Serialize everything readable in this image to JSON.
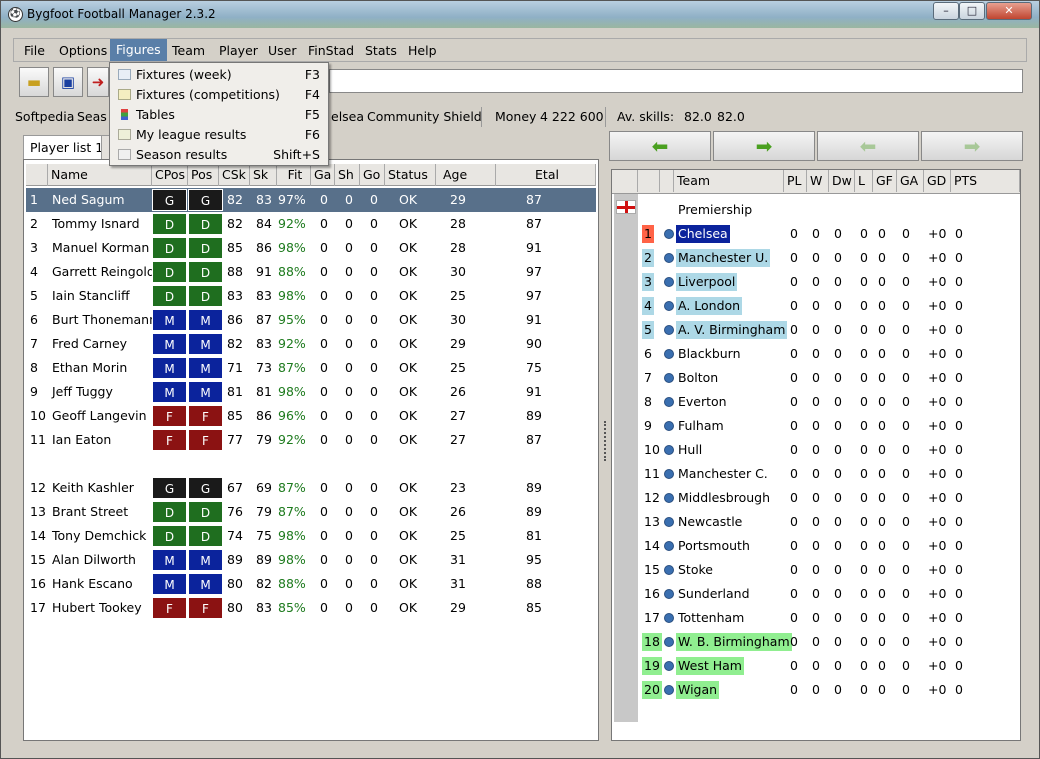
{
  "window": {
    "title": "Bygfoot Football Manager 2.3.2",
    "minimize": "–",
    "maximize": "□",
    "close": "✕"
  },
  "menu": [
    "File",
    "Options",
    "Figures",
    "Team",
    "Player",
    "User",
    "FinStad",
    "Stats",
    "Help"
  ],
  "figures_menu": [
    {
      "label": "Fixtures (week)",
      "shortcut": "F3",
      "icon": "calendar-icon"
    },
    {
      "label": "Fixtures (competitions)",
      "shortcut": "F4",
      "icon": "calendar-icon"
    },
    {
      "label": "Tables",
      "shortcut": "F5",
      "icon": "table-icon"
    },
    {
      "label": "My league results",
      "shortcut": "F6",
      "icon": "results-icon"
    },
    {
      "label": "Season results",
      "shortcut": "Shift+S",
      "icon": "season-icon"
    }
  ],
  "infobar": {
    "softpedia": "Softpedia",
    "season_prefix": "Seas",
    "comp_partial": "elsea",
    "competition": "Community Shield",
    "money_label": "Money",
    "money_value": "4 222 600",
    "skills_label": "Av. skills:",
    "skills_a": "82.0",
    "skills_b": "82.0"
  },
  "tabs": {
    "player_list": "Player list 1",
    "other": "P"
  },
  "player_columns": [
    "Name",
    "CPos",
    "Pos",
    "CSk",
    "Sk",
    "Fit",
    "Ga",
    "Sh",
    "Go",
    "Status",
    "Age",
    "Etal"
  ],
  "players": [
    {
      "n": "1",
      "name": "Ned Sagum",
      "cpos": "G",
      "pos": "G",
      "csk": "82",
      "sk": "83",
      "fit": "97%",
      "ga": "0",
      "sh": "0",
      "go": "0",
      "status": "OK",
      "age": "29",
      "etal": "87"
    },
    {
      "n": "2",
      "name": "Tommy Isnard",
      "cpos": "D",
      "pos": "D",
      "csk": "82",
      "sk": "84",
      "fit": "92%",
      "ga": "0",
      "sh": "0",
      "go": "0",
      "status": "OK",
      "age": "28",
      "etal": "87"
    },
    {
      "n": "3",
      "name": "Manuel Korman",
      "cpos": "D",
      "pos": "D",
      "csk": "85",
      "sk": "86",
      "fit": "98%",
      "ga": "0",
      "sh": "0",
      "go": "0",
      "status": "OK",
      "age": "28",
      "etal": "91"
    },
    {
      "n": "4",
      "name": "Garrett Reingold",
      "cpos": "D",
      "pos": "D",
      "csk": "88",
      "sk": "91",
      "fit": "88%",
      "ga": "0",
      "sh": "0",
      "go": "0",
      "status": "OK",
      "age": "30",
      "etal": "97"
    },
    {
      "n": "5",
      "name": "Iain Stancliff",
      "cpos": "D",
      "pos": "D",
      "csk": "83",
      "sk": "83",
      "fit": "98%",
      "ga": "0",
      "sh": "0",
      "go": "0",
      "status": "OK",
      "age": "25",
      "etal": "97"
    },
    {
      "n": "6",
      "name": "Burt Thonemann",
      "cpos": "M",
      "pos": "M",
      "csk": "86",
      "sk": "87",
      "fit": "95%",
      "ga": "0",
      "sh": "0",
      "go": "0",
      "status": "OK",
      "age": "30",
      "etal": "91"
    },
    {
      "n": "7",
      "name": "Fred Carney",
      "cpos": "M",
      "pos": "M",
      "csk": "82",
      "sk": "83",
      "fit": "92%",
      "ga": "0",
      "sh": "0",
      "go": "0",
      "status": "OK",
      "age": "29",
      "etal": "90"
    },
    {
      "n": "8",
      "name": "Ethan Morin",
      "cpos": "M",
      "pos": "M",
      "csk": "71",
      "sk": "73",
      "fit": "87%",
      "ga": "0",
      "sh": "0",
      "go": "0",
      "status": "OK",
      "age": "25",
      "etal": "75"
    },
    {
      "n": "9",
      "name": "Jeff Tuggy",
      "cpos": "M",
      "pos": "M",
      "csk": "81",
      "sk": "81",
      "fit": "98%",
      "ga": "0",
      "sh": "0",
      "go": "0",
      "status": "OK",
      "age": "26",
      "etal": "91"
    },
    {
      "n": "10",
      "name": "Geoff Langevin",
      "cpos": "F",
      "pos": "F",
      "csk": "85",
      "sk": "86",
      "fit": "96%",
      "ga": "0",
      "sh": "0",
      "go": "0",
      "status": "OK",
      "age": "27",
      "etal": "89"
    },
    {
      "n": "11",
      "name": "Ian Eaton",
      "cpos": "F",
      "pos": "F",
      "csk": "77",
      "sk": "79",
      "fit": "92%",
      "ga": "0",
      "sh": "0",
      "go": "0",
      "status": "OK",
      "age": "27",
      "etal": "87"
    },
    {
      "n": "12",
      "name": "Keith Kashler",
      "cpos": "G",
      "pos": "G",
      "csk": "67",
      "sk": "69",
      "fit": "87%",
      "ga": "0",
      "sh": "0",
      "go": "0",
      "status": "OK",
      "age": "23",
      "etal": "89"
    },
    {
      "n": "13",
      "name": "Brant Street",
      "cpos": "D",
      "pos": "D",
      "csk": "76",
      "sk": "79",
      "fit": "87%",
      "ga": "0",
      "sh": "0",
      "go": "0",
      "status": "OK",
      "age": "26",
      "etal": "89"
    },
    {
      "n": "14",
      "name": "Tony Demchick",
      "cpos": "D",
      "pos": "D",
      "csk": "74",
      "sk": "75",
      "fit": "98%",
      "ga": "0",
      "sh": "0",
      "go": "0",
      "status": "OK",
      "age": "25",
      "etal": "81"
    },
    {
      "n": "15",
      "name": "Alan Dilworth",
      "cpos": "M",
      "pos": "M",
      "csk": "89",
      "sk": "89",
      "fit": "98%",
      "ga": "0",
      "sh": "0",
      "go": "0",
      "status": "OK",
      "age": "31",
      "etal": "95"
    },
    {
      "n": "16",
      "name": "Hank Escano",
      "cpos": "M",
      "pos": "M",
      "csk": "80",
      "sk": "82",
      "fit": "88%",
      "ga": "0",
      "sh": "0",
      "go": "0",
      "status": "OK",
      "age": "31",
      "etal": "88"
    },
    {
      "n": "17",
      "name": "Hubert Tookey",
      "cpos": "F",
      "pos": "F",
      "csk": "80",
      "sk": "83",
      "fit": "85%",
      "ga": "0",
      "sh": "0",
      "go": "0",
      "status": "OK",
      "age": "29",
      "etal": "85"
    }
  ],
  "position_colors": {
    "G": "#1a1a1a",
    "D": "#1f6e1f",
    "M": "#0b239c",
    "F": "#8b1212"
  },
  "table_columns": [
    "Team",
    "PL",
    "W",
    "Dw",
    "L",
    "GF",
    "GA",
    "GD",
    "PTS"
  ],
  "league_name": "Premiership",
  "teams": [
    {
      "r": "1",
      "name": "Chelsea",
      "pl": "0",
      "w": "0",
      "dw": "0",
      "l": "0",
      "gf": "0",
      "ga": "0",
      "gd": "+0",
      "pts": "0",
      "zone": "champ"
    },
    {
      "r": "2",
      "name": "Manchester U.",
      "pl": "0",
      "w": "0",
      "dw": "0",
      "l": "0",
      "gf": "0",
      "ga": "0",
      "gd": "+0",
      "pts": "0",
      "zone": "cl"
    },
    {
      "r": "3",
      "name": "Liverpool",
      "pl": "0",
      "w": "0",
      "dw": "0",
      "l": "0",
      "gf": "0",
      "ga": "0",
      "gd": "+0",
      "pts": "0",
      "zone": "cl"
    },
    {
      "r": "4",
      "name": "A. London",
      "pl": "0",
      "w": "0",
      "dw": "0",
      "l": "0",
      "gf": "0",
      "ga": "0",
      "gd": "+0",
      "pts": "0",
      "zone": "cl"
    },
    {
      "r": "5",
      "name": "A. V. Birmingham",
      "pl": "0",
      "w": "0",
      "dw": "0",
      "l": "0",
      "gf": "0",
      "ga": "0",
      "gd": "+0",
      "pts": "0",
      "zone": "cl"
    },
    {
      "r": "6",
      "name": "Blackburn",
      "pl": "0",
      "w": "0",
      "dw": "0",
      "l": "0",
      "gf": "0",
      "ga": "0",
      "gd": "+0",
      "pts": "0",
      "zone": ""
    },
    {
      "r": "7",
      "name": "Bolton",
      "pl": "0",
      "w": "0",
      "dw": "0",
      "l": "0",
      "gf": "0",
      "ga": "0",
      "gd": "+0",
      "pts": "0",
      "zone": ""
    },
    {
      "r": "8",
      "name": "Everton",
      "pl": "0",
      "w": "0",
      "dw": "0",
      "l": "0",
      "gf": "0",
      "ga": "0",
      "gd": "+0",
      "pts": "0",
      "zone": ""
    },
    {
      "r": "9",
      "name": "Fulham",
      "pl": "0",
      "w": "0",
      "dw": "0",
      "l": "0",
      "gf": "0",
      "ga": "0",
      "gd": "+0",
      "pts": "0",
      "zone": ""
    },
    {
      "r": "10",
      "name": "Hull",
      "pl": "0",
      "w": "0",
      "dw": "0",
      "l": "0",
      "gf": "0",
      "ga": "0",
      "gd": "+0",
      "pts": "0",
      "zone": ""
    },
    {
      "r": "11",
      "name": "Manchester C.",
      "pl": "0",
      "w": "0",
      "dw": "0",
      "l": "0",
      "gf": "0",
      "ga": "0",
      "gd": "+0",
      "pts": "0",
      "zone": ""
    },
    {
      "r": "12",
      "name": "Middlesbrough",
      "pl": "0",
      "w": "0",
      "dw": "0",
      "l": "0",
      "gf": "0",
      "ga": "0",
      "gd": "+0",
      "pts": "0",
      "zone": ""
    },
    {
      "r": "13",
      "name": "Newcastle",
      "pl": "0",
      "w": "0",
      "dw": "0",
      "l": "0",
      "gf": "0",
      "ga": "0",
      "gd": "+0",
      "pts": "0",
      "zone": ""
    },
    {
      "r": "14",
      "name": "Portsmouth",
      "pl": "0",
      "w": "0",
      "dw": "0",
      "l": "0",
      "gf": "0",
      "ga": "0",
      "gd": "+0",
      "pts": "0",
      "zone": ""
    },
    {
      "r": "15",
      "name": "Stoke",
      "pl": "0",
      "w": "0",
      "dw": "0",
      "l": "0",
      "gf": "0",
      "ga": "0",
      "gd": "+0",
      "pts": "0",
      "zone": ""
    },
    {
      "r": "16",
      "name": "Sunderland",
      "pl": "0",
      "w": "0",
      "dw": "0",
      "l": "0",
      "gf": "0",
      "ga": "0",
      "gd": "+0",
      "pts": "0",
      "zone": ""
    },
    {
      "r": "17",
      "name": "Tottenham",
      "pl": "0",
      "w": "0",
      "dw": "0",
      "l": "0",
      "gf": "0",
      "ga": "0",
      "gd": "+0",
      "pts": "0",
      "zone": ""
    },
    {
      "r": "18",
      "name": "W. B. Birmingham",
      "pl": "0",
      "w": "0",
      "dw": "0",
      "l": "0",
      "gf": "0",
      "ga": "0",
      "gd": "+0",
      "pts": "0",
      "zone": "rel"
    },
    {
      "r": "19",
      "name": "West Ham",
      "pl": "0",
      "w": "0",
      "dw": "0",
      "l": "0",
      "gf": "0",
      "ga": "0",
      "gd": "+0",
      "pts": "0",
      "zone": "rel"
    },
    {
      "r": "20",
      "name": "Wigan",
      "pl": "0",
      "w": "0",
      "dw": "0",
      "l": "0",
      "gf": "0",
      "ga": "0",
      "gd": "+0",
      "pts": "0",
      "zone": "rel"
    }
  ],
  "zone_colors": {
    "champ": "#0b239c",
    "cl": "#add8e6",
    "rel": "#90ee90",
    "rank_champ": "#ff6347"
  },
  "toolbar_icons": [
    "open-icon",
    "save-icon",
    "export-icon"
  ],
  "nav_arrows": [
    "arrow-left-icon",
    "arrow-right-icon",
    "arrow-left-faded-icon",
    "arrow-right-faded-icon"
  ]
}
